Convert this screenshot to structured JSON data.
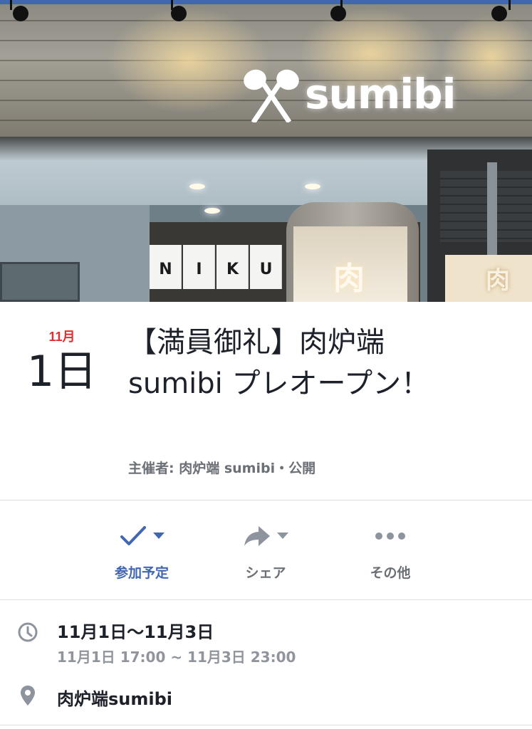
{
  "cover": {
    "logo_text": "sumibi",
    "noren_letters": [
      "N",
      "I",
      "K",
      "U"
    ],
    "shop_sign": "肉",
    "side_sign": "肉"
  },
  "event": {
    "month": "11月",
    "day": "1日",
    "title": "【満員御礼】肉炉端 sumibi プレオープン！",
    "host_line": "主催者: 肉炉端 sumibi・公開"
  },
  "actions": [
    {
      "label": "参加予定",
      "icon": "check-icon",
      "has_caret": true
    },
    {
      "label": "シェア",
      "icon": "share-arrow-icon",
      "has_caret": true
    },
    {
      "label": "その他",
      "icon": "more-dots-icon",
      "has_caret": false
    }
  ],
  "details": {
    "date_range": "11月1日〜11月3日",
    "time_range": "11月1日 17:00 ~ 11月3日 23:00",
    "location": "肉炉端sumibi"
  },
  "colors": {
    "accent": "#4267b2",
    "month_red": "#e12e2e",
    "secondary_text": "#90949c",
    "icon_gray": "#8d949e"
  }
}
